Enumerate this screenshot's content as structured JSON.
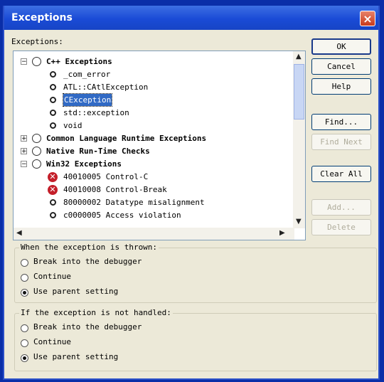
{
  "window": {
    "title": "Exceptions",
    "close_glyph": "×"
  },
  "exceptions_label": "Exceptions:",
  "tree": {
    "items": [
      {
        "label": "C++ Exceptions",
        "level": 0,
        "bold": true,
        "expander": "−"
      },
      {
        "label": "_com_error",
        "level": 1
      },
      {
        "label": "ATL::CAtlException",
        "level": 1
      },
      {
        "label": "CException",
        "level": 1,
        "selected": true
      },
      {
        "label": "std::exception",
        "level": 1
      },
      {
        "label": "void",
        "level": 1
      },
      {
        "label": "Common Language Runtime Exceptions",
        "level": 0,
        "bold": true,
        "expander": "+"
      },
      {
        "label": "Native Run-Time Checks",
        "level": 0,
        "bold": true,
        "expander": "+"
      },
      {
        "label": "Win32 Exceptions",
        "level": 0,
        "bold": true,
        "expander": "−"
      },
      {
        "label": "40010005 Control-C",
        "level": 1,
        "icon": "stop-icon"
      },
      {
        "label": "40010008 Control-Break",
        "level": 1,
        "icon": "stop-icon"
      },
      {
        "label": "80000002 Datatype misalignment",
        "level": 1
      },
      {
        "label": "c0000005 Access violation",
        "level": 1
      }
    ]
  },
  "buttons": {
    "ok": "OK",
    "cancel": "Cancel",
    "help": "Help",
    "find": "Find...",
    "find_next": "Find Next",
    "clear_all": "Clear All",
    "add": "Add...",
    "delete": "Delete"
  },
  "thrown_group": {
    "title": "When the exception is thrown:",
    "options": [
      "Break into the debugger",
      "Continue",
      "Use parent setting"
    ],
    "selected": 2
  },
  "unhandled_group": {
    "title": "If the exception is not handled:",
    "options": [
      "Break into the debugger",
      "Continue",
      "Use parent setting"
    ],
    "selected": 2
  },
  "colors": {
    "titlebar": "#1a4bd6",
    "selection": "#316ac5",
    "stop_icon": "#c41f2a"
  }
}
